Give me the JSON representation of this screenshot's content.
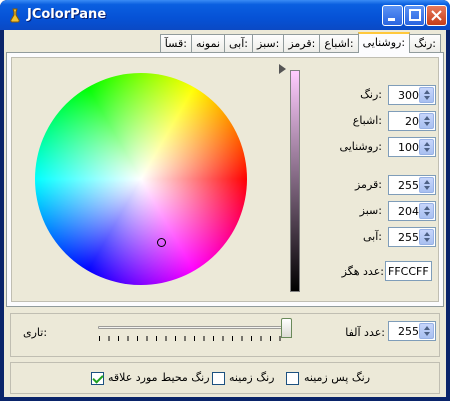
{
  "window": {
    "title": "JColorPane",
    "icon": "app-icon"
  },
  "tabs": [
    {
      "label": "رنگ:"
    },
    {
      "label": "روشنایی:",
      "active": true
    },
    {
      "label": "اشباع:"
    },
    {
      "label": "قرمز:"
    },
    {
      "label": "سبز:"
    },
    {
      "label": "آبی:"
    },
    {
      "label": "نمونه"
    },
    {
      "label": "قسآ:"
    }
  ],
  "fields": {
    "hue": {
      "label": "رنگ:",
      "value": "300"
    },
    "saturation": {
      "label": "اشباع:",
      "value": "20"
    },
    "brightness": {
      "label": "روشنایی:",
      "value": "100"
    },
    "red": {
      "label": "قرمز:",
      "value": "255"
    },
    "green": {
      "label": "سبز:",
      "value": "204"
    },
    "blue": {
      "label": "آبی:",
      "value": "255"
    },
    "hex": {
      "label": "عدد هگز:",
      "value": "FFCCFF"
    }
  },
  "alpha": {
    "label": "عدد آلفا:",
    "value": "255",
    "slider_label": "تاری:",
    "slider_level": 1.0
  },
  "options": {
    "background": {
      "label": "رنگ پس زمینه",
      "checked": false
    },
    "foreground": {
      "label": "رنگ زمینه",
      "checked": false
    },
    "favorite": {
      "label": "رنگ محیط مورد علاقه",
      "checked": true
    }
  },
  "colors": {
    "selected": "#FFCCFF",
    "titlebar": "#0652D6",
    "window_bg": "#ECE9D8"
  }
}
